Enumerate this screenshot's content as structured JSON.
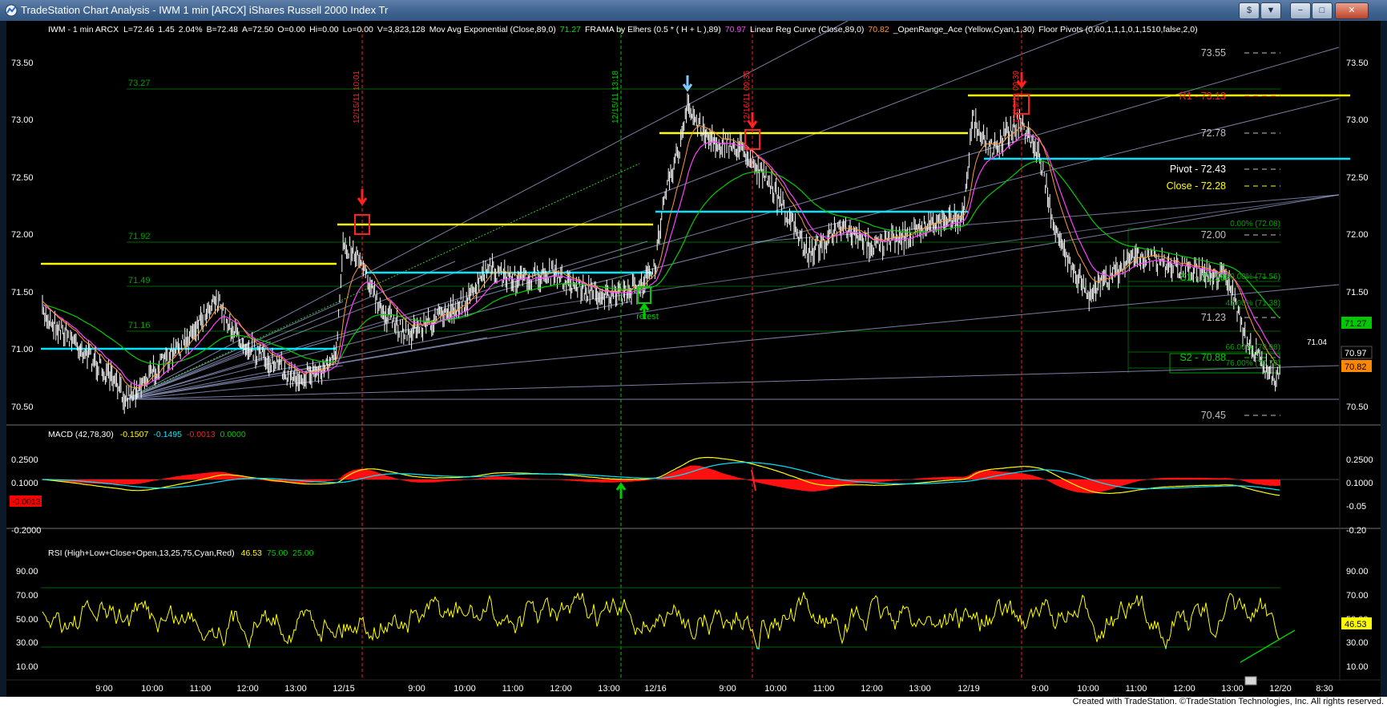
{
  "window": {
    "title": "TradeStation Chart Analysis - IWM 1 min [ARCX] iShares Russell 2000 Index Tr",
    "buttons": {
      "restore": "$",
      "arrow": "▼",
      "minimize": "−",
      "maximize": "□",
      "close": "✕"
    }
  },
  "price_pane": {
    "indicators": [
      {
        "text": "IWM - 1 min  ARCX",
        "color": "#ffffff"
      },
      {
        "text": "L=72.46",
        "color": "#ffffff"
      },
      {
        "text": "1.45",
        "color": "#ffffff"
      },
      {
        "text": "2.04%",
        "color": "#ffffff"
      },
      {
        "text": "B=72.48",
        "color": "#ffffff"
      },
      {
        "text": "A=72.50",
        "color": "#ffffff"
      },
      {
        "text": "O=0.00",
        "color": "#ffffff"
      },
      {
        "text": "Hi=0.00",
        "color": "#ffffff"
      },
      {
        "text": "Lo=0.00",
        "color": "#ffffff"
      },
      {
        "text": "V=3,823,128",
        "color": "#ffffff"
      },
      {
        "text": "Mov Avg Exponential (Close,89,0)",
        "color": "#ffffff"
      },
      {
        "text": "71.27",
        "color": "#00e600"
      },
      {
        "text": "FRAMA by Elhers (0.5 * ( H + L ),89)",
        "color": "#ffffff"
      },
      {
        "text": "70.97",
        "color": "#ff40ff"
      },
      {
        "text": "Linear Reg Curve (Close,89,0)",
        "color": "#ffffff"
      },
      {
        "text": "70.82",
        "color": "#ff9933"
      },
      {
        "text": "_OpenRange_Ace (Yellow,Cyan,1,30)",
        "color": "#ffffff"
      },
      {
        "text": "Floor Pivots (0,60,1,1,1,0,1,1510,false,2,0)",
        "color": "#ffffff"
      }
    ],
    "axis_labels": [
      "73.50",
      "73.00",
      "72.50",
      "72.00",
      "71.50",
      "71.00",
      "70.50"
    ],
    "last_price_boxes": [
      {
        "text": "71.27",
        "bg": "#00c800",
        "fg": "#000000"
      },
      {
        "text": "70.97",
        "bg": "#000000",
        "fg": "#ffffff"
      },
      {
        "text": "70.82",
        "bg": "#ff8800",
        "fg": "#000000"
      }
    ],
    "fib_left_labels": [
      "73.27",
      "71.92",
      "71.49",
      "71.16"
    ],
    "pivot_labels": [
      {
        "text": "73.55",
        "color": "#bfbfbf"
      },
      {
        "text": "R1 - 73.13",
        "color": "#ff2020"
      },
      {
        "text": "72.78",
        "color": "#bfbfbf"
      },
      {
        "text": "Pivot - 72.43",
        "color": "#ffffff"
      },
      {
        "text": "Close - 72.28",
        "color": "#ffff00"
      },
      {
        "text": "72.00",
        "color": "#bfbfbf"
      },
      {
        "text": "S1 - 71.58",
        "color": "#00cc00"
      },
      {
        "text": "71.23",
        "color": "#bfbfbf"
      },
      {
        "text": "S2 - 70.88",
        "color": "#00cc00"
      },
      {
        "text": "70.45",
        "color": "#bfbfbf"
      }
    ],
    "fib_right_labels": [
      "0.00% (72.08)",
      "30.00% (71.56)",
      "42.00% (71.38)",
      "66.00% (70.98)",
      "76.00% (70.79)"
    ],
    "small_label": "71.04",
    "retest_label": "retest",
    "vline_labels": [
      "12/15/11 10:01",
      "12/15/11 13:18",
      "12/16/11 09:35",
      "12/19/11 09:39"
    ]
  },
  "macd_pane": {
    "indicator": "MACD (42,78,30)",
    "values": [
      {
        "text": "-0.1507",
        "color": "#ffff00"
      },
      {
        "text": "-0.1495",
        "color": "#00e5ff"
      },
      {
        "text": "-0.0013",
        "color": "#ff2020"
      },
      {
        "text": "0.0000",
        "color": "#00cc00"
      }
    ],
    "axis_labels": [
      "0.2500",
      "0.1000",
      "-0.05",
      "-0.20"
    ],
    "left_axis_labels": [
      "0.2500",
      "0.1000",
      "-0.2000"
    ],
    "box_label": "-0.0013"
  },
  "rsi_pane": {
    "indicator": "RSI (High+Low+Close+Open,13,25,75,Cyan,Red)",
    "values": [
      {
        "text": "46.53",
        "color": "#ffff00"
      },
      {
        "text": "75.00",
        "color": "#00cc00"
      },
      {
        "text": "25.00",
        "color": "#00cc00"
      }
    ],
    "axis_labels": [
      "90.00",
      "70.00",
      "50.00",
      "30.00",
      "10.00"
    ],
    "last_box": "46.53"
  },
  "time_axis": [
    "9:00",
    "10:00",
    "11:00",
    "12:00",
    "13:00",
    "12/15",
    "9:00",
    "10:00",
    "11:00",
    "12:00",
    "13:00",
    "12/16",
    "9:00",
    "10:00",
    "11:00",
    "12:00",
    "13:00",
    "12/19",
    "9:00",
    "10:00",
    "11:00",
    "12:00",
    "13:00",
    "12/20",
    "8:30"
  ],
  "status": "Created with TradeStation. ©TradeStation Technologies, Inc. All rights reserved.",
  "colors": {
    "yellow": "#ffff00",
    "cyan": "#00e5ff",
    "green": "#00cc00",
    "red": "#ff2020",
    "magenta": "#ff40ff",
    "orange": "#ff9933"
  }
}
